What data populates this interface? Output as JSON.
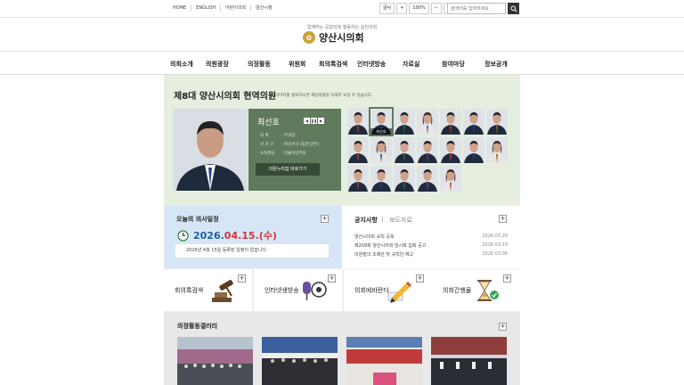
{
  "top": {
    "links": [
      "HOME",
      "ENGLISH",
      "어린이의회",
      "양산시청"
    ],
    "tools": [
      "글씨",
      "+",
      "100%",
      "−"
    ],
    "search_placeholder": "검색어를 입력하세요"
  },
  "header": {
    "slogan": "함께하는 공감의정 행동하는 실천의회",
    "title": "양산시의회"
  },
  "gnb": [
    "의회소개",
    "의원광장",
    "의정활동",
    "위원회",
    "회의록검색",
    "인터넷방송",
    "자료실",
    "참여마당",
    "정보공개"
  ],
  "council": {
    "title": "제8대 양산시의회 현역의원",
    "subtitle": "이미지를 클릭하시면 해당의원을 자세히 보실 수 있습니다.",
    "name": "최선호",
    "rows": [
      {
        "k": "직 위",
        "v": "부의장"
      },
      {
        "k": "선 거 구",
        "v": "마선거구 (동면,양주)"
      },
      {
        "k": "소속정당",
        "v": "더불어민주당"
      }
    ],
    "btn": "의원누리집 바로가기",
    "selected_caption": "최선호"
  },
  "schedule": {
    "title": "오늘의 의사일정",
    "date_prefix": "2026.",
    "date_mid": "04.15.",
    "date_suffix": "(수)",
    "message": "2026년 4월 15일 등록된 일정이 없습니다"
  },
  "notice": {
    "tab_active": "공지사항",
    "tab_inactive": "보도자료",
    "items": [
      {
        "t": "양산시의회 규칙 공포",
        "d": "2026.03.20"
      },
      {
        "t": "제209회 양산시의회 임시회 집회 공고",
        "d": "2026.03.10"
      },
      {
        "t": "의원발의 조례안 및 규칙안 예고",
        "d": "2026.03.06"
      }
    ]
  },
  "quick": [
    "회의록검색",
    "인터넷생방송",
    "의회에바란다",
    "의회간행물"
  ],
  "gallery": {
    "title": "의정활동갤러리"
  },
  "colors": {
    "accent": "#5f7a5c",
    "date_blue": "#1b5fa8",
    "date_red": "#d4343d"
  }
}
